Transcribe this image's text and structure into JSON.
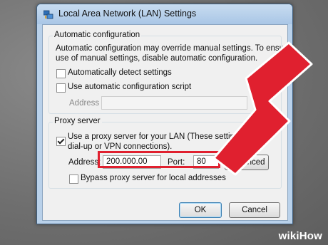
{
  "window": {
    "title": "Local Area Network (LAN) Settings",
    "icon": "network-settings-icon"
  },
  "auto_config": {
    "group_label": "Automatic configuration",
    "description_line1": "Automatic configuration may override manual settings.  To ensure the",
    "description_line2": "use of manual settings, disable automatic configuration.",
    "detect_label": "Automatically detect settings",
    "detect_checked": false,
    "script_label": "Use automatic configuration script",
    "script_checked": false,
    "address_label": "Address",
    "address_value": ""
  },
  "proxy": {
    "group_label": "Proxy server",
    "use_proxy_label_line1": "Use a proxy server for your LAN (These settings w",
    "use_proxy_label_line2": "dial-up or VPN connections).",
    "use_proxy_checked": true,
    "address_label": "Address:",
    "address_value": "200.000.00",
    "port_label": "Port:",
    "port_value": "80",
    "advanced_label": "Advanced",
    "bypass_label": "Bypass proxy server for local addresses",
    "bypass_checked": false
  },
  "buttons": {
    "ok": "OK",
    "cancel": "Cancel"
  },
  "watermark": {
    "wiki": "wiki",
    "how": "How"
  },
  "colors": {
    "annotation_red": "#e0202f",
    "titlebar": "#b9d1ea"
  }
}
